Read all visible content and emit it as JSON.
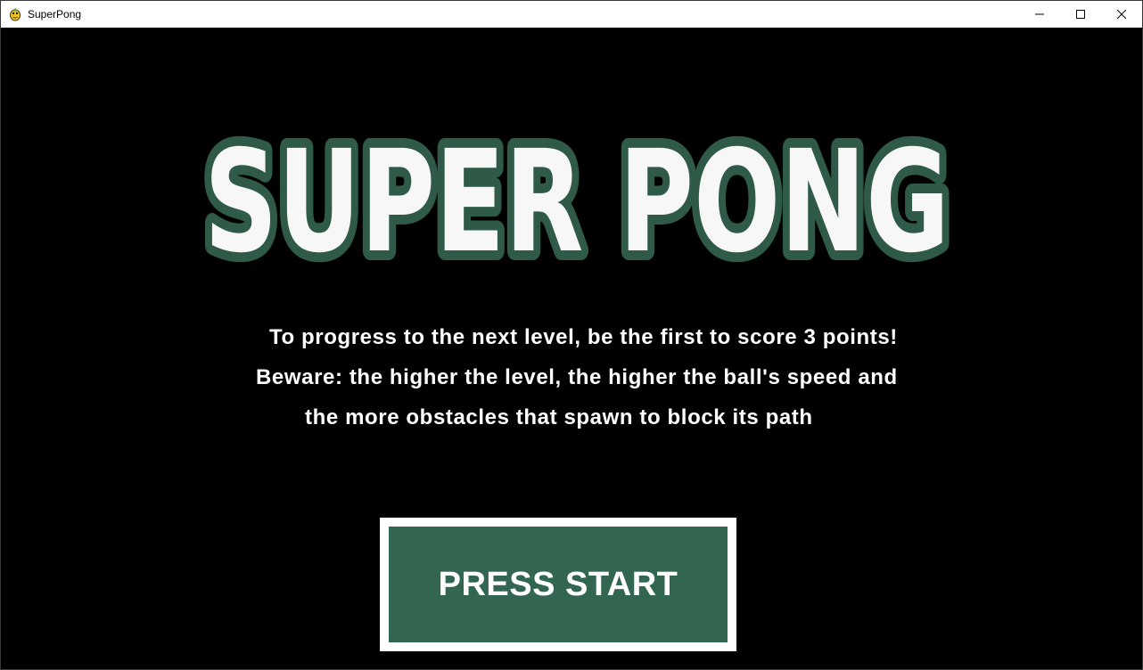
{
  "window": {
    "title": "SuperPong",
    "app_icon": "pygame-snake-icon",
    "controls": [
      "minimize-icon",
      "maximize-icon",
      "close-icon"
    ]
  },
  "logo": {
    "text": "SUPER PONG",
    "fill_color": "#f7f7f7",
    "outline_color": "#2f5a48"
  },
  "instructions": [
    "To progress to the next level, be the first to score 3 points!",
    "Beware: the higher the level, the higher the ball's speed and",
    "the more obstacles that spawn to block its path"
  ],
  "start_button": {
    "label": "PRESS START",
    "color": "#336651",
    "border_color": "#ffffff"
  },
  "colors": {
    "background": "#000000",
    "titlebar": "#ffffff",
    "text": "#ffffff"
  }
}
